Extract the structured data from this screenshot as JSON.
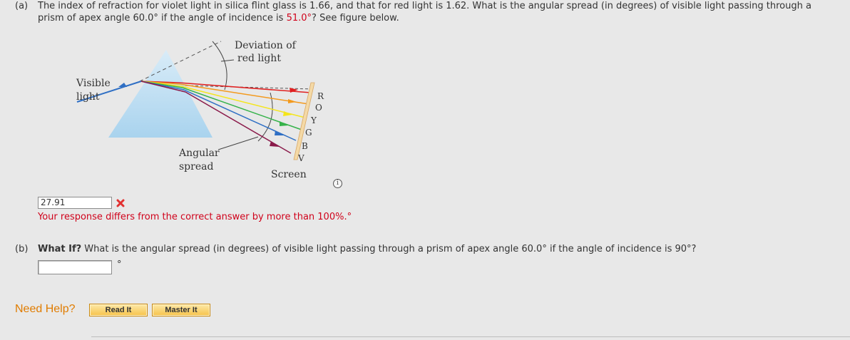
{
  "part_a": {
    "label": "(a)",
    "question_line1": "The index of refraction for violet light in silica flint glass is 1.66, and that for red light is 1.62. What is the angular spread (in degrees) of visible light passing through a",
    "question_line2_pre": "prism of apex angle 60.0° if the angle of incidence is ",
    "question_value": "51.0°",
    "question_line2_post": "? See figure below.",
    "answer_value": "27.91",
    "feedback": "Your response differs from the correct answer by more than 100%.",
    "unit": "°"
  },
  "figure": {
    "label_visible": "Visible",
    "label_light": "light",
    "label_deviation1": "Deviation of",
    "label_deviation2": "red light",
    "label_angular": "Angular",
    "label_spread": "spread",
    "label_screen": "Screen",
    "spectrum": [
      "R",
      "O",
      "Y",
      "G",
      "B",
      "V"
    ],
    "info_icon_glyph": "i"
  },
  "part_b": {
    "label": "(b)",
    "what_if": "What If?",
    "question": "What is the angular spread (in degrees) of visible light passing through a prism of apex angle 60.0° if the angle of incidence is 90°?",
    "answer_value": "",
    "unit": "°"
  },
  "help": {
    "label": "Need Help?",
    "read_it": "Read It",
    "master_it": "Master It"
  },
  "colors": {
    "need_help": "#e07c00",
    "error": "#d0021b",
    "red_ray": "#e02020",
    "orange_ray": "#f39a1e",
    "yellow_ray": "#f4e51c",
    "green_ray": "#35b24a",
    "blue_ray": "#2f6fc4",
    "violet_ray": "#8a1a4a"
  }
}
